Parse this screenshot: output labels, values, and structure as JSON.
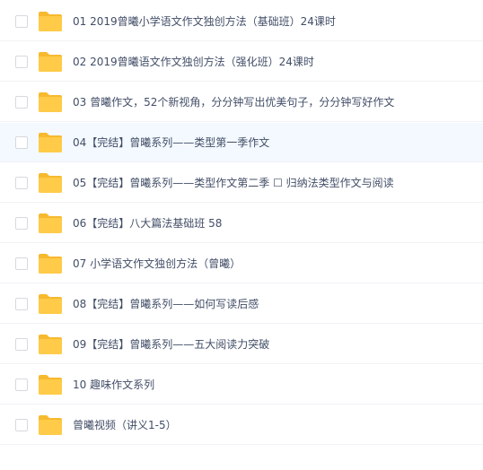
{
  "file_list": {
    "hover_index": 3,
    "folder_icon": "folder-icon",
    "colors": {
      "folder": "#ffcb48",
      "folder_tab": "#f7b92e",
      "text": "#424e67",
      "hover_bg": "#f3f9fe"
    },
    "items": [
      {
        "name": "01 2019曾曦小学语文作文独创方法（基础班）24课时"
      },
      {
        "name": "02 2019曾曦语文作文独创方法（强化班）24课时"
      },
      {
        "name": "03 曾曦作文，52个新视角，分分钟写出优美句子，分分钟写好作文"
      },
      {
        "name": "04【完结】曾曦系列——类型第一季作文"
      },
      {
        "name": "05【完结】曾曦系列——类型作文第二季 ☐ 归纳法类型作文与阅读"
      },
      {
        "name": "06【完结】八大篇法基础班 58"
      },
      {
        "name": "07 小学语文作文独创方法（曾曦）"
      },
      {
        "name": "08【完结】曾曦系列——如何写读后感"
      },
      {
        "name": "09【完结】曾曦系列——五大阅读力突破"
      },
      {
        "name": "10 趣味作文系列"
      },
      {
        "name": "曾曦视频（讲义1-5）"
      }
    ]
  }
}
